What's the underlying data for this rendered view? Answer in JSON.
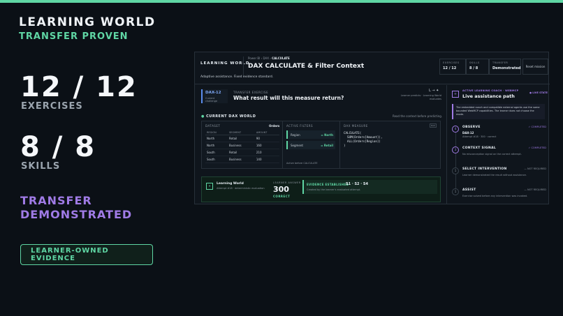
{
  "hero": {
    "title": "LEARNING WORLD",
    "subtitle": "TRANSFER PROVEN",
    "exercises_value": "12 / 12",
    "exercises_label": "EXERCISES",
    "skills_value": "8 / 8",
    "skills_label": "SKILLS",
    "transfer_line1": "TRANSFER",
    "transfer_line2": "DEMONSTRATED",
    "evidence_button": "LEARNER-OWNED EVIDENCE"
  },
  "app": {
    "brand": "LEARNING WORLD",
    "breadcrumb": [
      "Power BI",
      "DAX",
      "CALCULATE"
    ],
    "breadcrumb_sep": "›",
    "title": "DAX CALCULATE & Filter Context",
    "note": "Adaptive assistance. Fixed evidence standard.",
    "stats": [
      {
        "key": "EXERCISES",
        "value": "12 / 12"
      },
      {
        "key": "SKILLS",
        "value": "8 / 8"
      },
      {
        "key": "TRANSFER",
        "value": "Demonstrated"
      }
    ],
    "reset_label": "Reset mission"
  },
  "exercise": {
    "tag": "DAX-12",
    "tag_sub": "Current challenge",
    "label": "TRANSFER EXERCISE",
    "question": "What result will this measure return?",
    "lr_indicator": "L → ✦",
    "lr_note": "Learner predicts · Learning World evaluates"
  },
  "world": {
    "label": "CURRENT DAX WORLD",
    "note": "Read the context before predicting.",
    "dataset": {
      "header": "DATASET",
      "table_name": "Orders",
      "columns": [
        "REGION",
        "SEGMENT",
        "AMOUNT"
      ],
      "rows": [
        [
          "North",
          "Retail",
          "90"
        ],
        [
          "North",
          "Business",
          "160"
        ],
        [
          "South",
          "Retail",
          "210"
        ],
        [
          "South",
          "Business",
          "140"
        ]
      ]
    },
    "filters": {
      "header": "ACTIVE FILTERS",
      "items": [
        {
          "name": "Region",
          "value": "North"
        },
        {
          "name": "Segment",
          "value": "Retail"
        }
      ],
      "note": "Active before CALCULATE"
    },
    "measure": {
      "header": "DAX MEASURE",
      "badge": "DAX",
      "code": "CALCULATE(\n  SUM(Orders[Amount]),\n  ALL(Orders[Region])\n)"
    }
  },
  "result": {
    "icon": "✦",
    "title": "Learning World",
    "subtitle": "Attempt #18 · deterministic evaluation",
    "answer_label": "LEARNER ANSWER",
    "answer_value": "300",
    "answer_status": "CORRECT",
    "evidence_key": "EVIDENCE ESTABLISHED",
    "evidence_value": "S1 · S2 · S4",
    "evidence_sub": "Created by the learner's evaluated attempt."
  },
  "coach": {
    "icon": "+",
    "label": "ACTIVE LEARNING COACH · WEBMCP",
    "title": "Live assistance path",
    "live": "● LIVE STATE",
    "note": "The embedded coach and compatible external agents use the same bounded WebMCP capabilities. The learner does not choose the mode.",
    "steps": [
      {
        "num": "4",
        "name": "OBSERVE",
        "status": "✓ COMPLETED",
        "detail1": "DAX-12",
        "detail2": "Attempt #18 · 300 · correct",
        "done": true
      },
      {
        "num": "3",
        "name": "CONTEXT SIGNAL",
        "status": "✓ COMPLETED",
        "detail1": "",
        "detail2": "No misconception signal on the correct attempt.",
        "done": true
      },
      {
        "num": "1",
        "name": "SELECT INTERVENTION",
        "status": "— NOT REQUIRED",
        "detail1": "",
        "detail2": "Learner demonstrated the result without assistance.",
        "done": false
      },
      {
        "num": "1",
        "name": "ASSIST",
        "status": "— NOT REQUIRED",
        "detail1": "",
        "detail2": "Exercise solved before any intervention was invoked.",
        "done": false
      }
    ]
  },
  "colors": {
    "accent_green": "#5fd6a4",
    "accent_purple": "#a07be6",
    "accent_blue": "#5b8def",
    "background": "#0b1016"
  }
}
